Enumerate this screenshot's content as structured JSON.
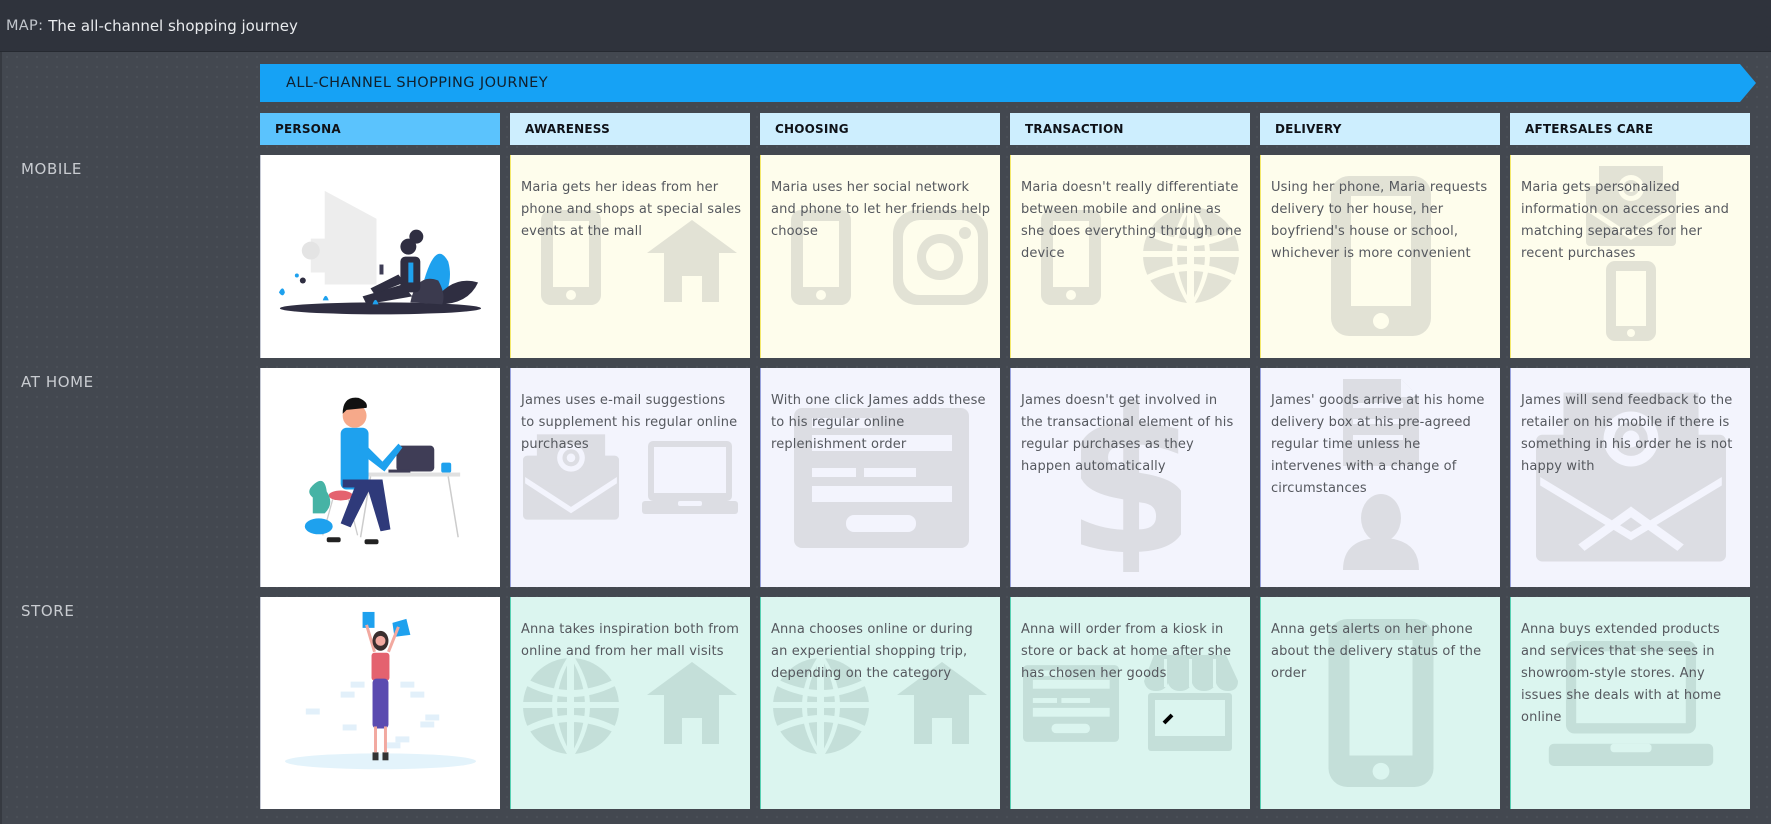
{
  "window": {
    "title_prefix": "MAP:",
    "title": "The all-channel shopping journey"
  },
  "banner": {
    "label": "ALL-CHANNEL SHOPPING JOURNEY",
    "color": "#16a2f5"
  },
  "columns": [
    {
      "label": "PERSONA"
    },
    {
      "label": "AWARENESS"
    },
    {
      "label": "CHOOSING"
    },
    {
      "label": "TRANSACTION"
    },
    {
      "label": "DELIVERY"
    },
    {
      "label": "AFTERSALES CARE"
    }
  ],
  "rows": [
    {
      "label": "MOBILE",
      "persona_illustration": "woman-sitting-with-phone",
      "cells": [
        {
          "text": "Maria gets her ideas from her phone and shops at special sales events at the mall",
          "icons": [
            "phone-icon",
            "house-icon"
          ]
        },
        {
          "text": "Maria uses her social network and phone to let her friends help choose",
          "icons": [
            "phone-icon",
            "instagram-icon"
          ]
        },
        {
          "text": "Maria doesn't really differentiate between mobile and online as she does everything through one device",
          "icons": [
            "phone-icon",
            "globe-icon"
          ]
        },
        {
          "text": "Using her phone, Maria requests delivery to her house, her boyfriend's house or school, whichever is more convenient",
          "icons": [
            "phone-icon"
          ]
        },
        {
          "text": "Maria gets personalized information on accessories and matching separates for her recent purchases",
          "icons": [
            "email-icon",
            "phone-icon"
          ]
        }
      ]
    },
    {
      "label": "AT HOME",
      "persona_illustration": "man-at-desk-with-laptop",
      "cells": [
        {
          "text": "James uses e-mail suggestions to supplement his regular online purchases",
          "icons": [
            "email-icon",
            "laptop-icon"
          ]
        },
        {
          "text": "With one click James adds these to his regular online replenishment order",
          "icons": [
            "form-icon"
          ]
        },
        {
          "text": "James doesn't get involved in the transactional element of his regular purchases as they happen automatically",
          "icons": [
            "dollar-icon"
          ]
        },
        {
          "text": "James' goods arrive at his home delivery box at his pre-agreed regular time unless he intervenes with a change of circumstances",
          "icons": [
            "document-icon",
            "user-icon"
          ]
        },
        {
          "text": "James will send feedback to the retailer on his mobile if there is something in his order he is not happy with",
          "icons": [
            "email-icon"
          ]
        }
      ]
    },
    {
      "label": "STORE",
      "persona_illustration": "woman-with-shopping-bags",
      "cells": [
        {
          "text": "Anna takes inspiration both from online and from her mall visits",
          "icons": [
            "globe-icon",
            "house-icon"
          ]
        },
        {
          "text": "Anna chooses online or during an experiential shopping trip, depending on the category",
          "icons": [
            "globe-icon",
            "house-icon"
          ]
        },
        {
          "text": "Anna will order from a kiosk in store or back at home after she has chosen her goods",
          "icons": [
            "form-icon",
            "store-icon"
          ]
        },
        {
          "text": "Anna gets alerts on her phone about the delivery status of the order",
          "icons": [
            "phone-icon"
          ]
        },
        {
          "text": "Anna buys extended products and services that she sees in showroom-style stores. Any issues she deals with at home online",
          "icons": [
            "laptop-icon"
          ]
        }
      ]
    }
  ],
  "colors": {
    "mobile_row": "#fefdec",
    "home_row": "#f3f4fd",
    "store_row": "#dbf5ef",
    "persona_header": "#5bc3fd",
    "stage_header": "#cdeefe"
  }
}
